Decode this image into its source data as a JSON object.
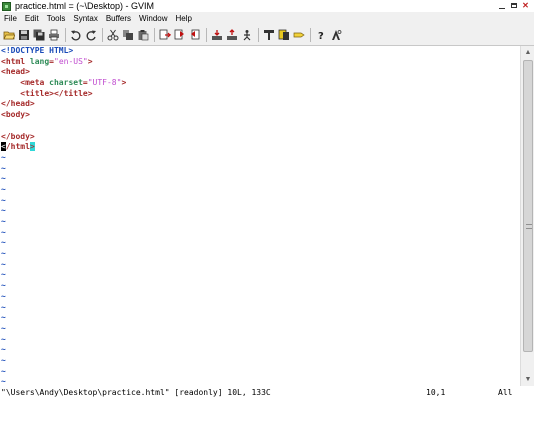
{
  "window": {
    "title": "practice.html = (~\\Desktop) - GVIM",
    "controls": [
      "minimize-icon",
      "maximize-icon",
      "close-icon"
    ]
  },
  "menu": {
    "items": [
      "File",
      "Edit",
      "Tools",
      "Syntax",
      "Buffers",
      "Window",
      "Help"
    ]
  },
  "toolbar": {
    "buttons": [
      {
        "name": "open-file-icon"
      },
      {
        "name": "save-icon"
      },
      {
        "name": "save-all-icon"
      },
      {
        "name": "print-icon"
      },
      {
        "name": "undo-icon"
      },
      {
        "name": "redo-icon"
      },
      {
        "name": "cut-icon"
      },
      {
        "name": "copy-icon"
      },
      {
        "name": "paste-icon"
      },
      {
        "name": "replace-icon"
      },
      {
        "name": "find-next-icon"
      },
      {
        "name": "find-prev-icon"
      },
      {
        "name": "load-session-icon"
      },
      {
        "name": "save-session-icon"
      },
      {
        "name": "run-script-icon"
      },
      {
        "name": "make-icon"
      },
      {
        "name": "shell-icon"
      },
      {
        "name": "tag-jump-icon"
      },
      {
        "name": "help-icon"
      },
      {
        "name": "find-help-icon"
      }
    ]
  },
  "editor": {
    "lines": [
      {
        "segments": [
          {
            "t": "<!DOCTYPE HTML>",
            "c": "doctype"
          }
        ]
      },
      {
        "segments": [
          {
            "t": "<html ",
            "c": "tag"
          },
          {
            "t": "lang",
            "c": "attr"
          },
          {
            "t": "=",
            "c": "tag"
          },
          {
            "t": "\"en-US\"",
            "c": "str"
          },
          {
            "t": ">",
            "c": "tag"
          }
        ]
      },
      {
        "segments": [
          {
            "t": "<head>",
            "c": "tag"
          }
        ]
      },
      {
        "segments": [
          {
            "t": "    ",
            "c": ""
          },
          {
            "t": "<meta ",
            "c": "tag"
          },
          {
            "t": "charset",
            "c": "attr"
          },
          {
            "t": "=",
            "c": "tag"
          },
          {
            "t": "\"UTF-8\"",
            "c": "str"
          },
          {
            "t": ">",
            "c": "tag"
          }
        ]
      },
      {
        "segments": [
          {
            "t": "    ",
            "c": ""
          },
          {
            "t": "<title></title>",
            "c": "tag"
          }
        ]
      },
      {
        "segments": [
          {
            "t": "</head>",
            "c": "tag"
          }
        ]
      },
      {
        "segments": [
          {
            "t": "<body>",
            "c": "tag"
          }
        ]
      },
      {
        "segments": [
          {
            "t": "",
            "c": ""
          }
        ]
      },
      {
        "segments": [
          {
            "t": "</body>",
            "c": "tag"
          }
        ]
      },
      {
        "segments": [
          {
            "t": "<",
            "c": "cursor"
          },
          {
            "t": "/html",
            "c": "tag"
          },
          {
            "t": ">",
            "c": "match"
          }
        ]
      }
    ],
    "tilde_char": "~",
    "tilde_count": 22
  },
  "status": {
    "message": "\"\\Users\\Andy\\Desktop\\practice.html\" [readonly] 10L, 133C",
    "position": "10,1",
    "scroll": "All"
  },
  "scrollbar": {
    "up_arrow": "▲",
    "down_arrow": "▼"
  }
}
